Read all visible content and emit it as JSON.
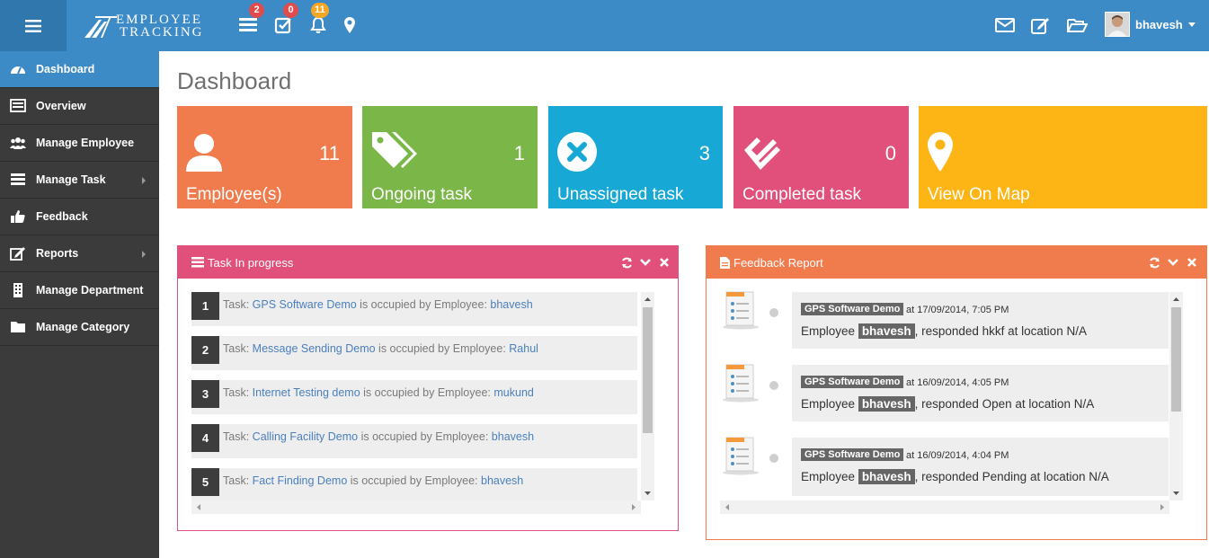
{
  "app": {
    "brand_line1": "EMPLOYEE",
    "brand_line2": "TRACKING"
  },
  "topbar": {
    "badges": {
      "tasks": "2",
      "checks": "0",
      "alerts": "11"
    },
    "user_name": "bhavesh"
  },
  "sidebar": {
    "items": [
      {
        "label": "Dashboard",
        "icon": "dashboard-icon"
      },
      {
        "label": "Overview",
        "icon": "overview-icon"
      },
      {
        "label": "Manage Employee",
        "icon": "users-icon"
      },
      {
        "label": "Manage Task",
        "icon": "tasks-icon"
      },
      {
        "label": "Feedback",
        "icon": "thumbs-up-icon"
      },
      {
        "label": "Reports",
        "icon": "edit-icon"
      },
      {
        "label": "Manage Department",
        "icon": "building-icon"
      },
      {
        "label": "Manage Category",
        "icon": "folder-icon"
      }
    ]
  },
  "main": {
    "title": "Dashboard",
    "tiles": [
      {
        "label": "Employee(s)",
        "count": "11",
        "color": "#f07c4e"
      },
      {
        "label": "Ongoing task",
        "count": "1",
        "color": "#7ab648"
      },
      {
        "label": "Unassigned task",
        "count": "3",
        "color": "#17a8d6"
      },
      {
        "label": "Completed task",
        "count": "0",
        "color": "#e0507a"
      },
      {
        "label": "View On Map",
        "count": "",
        "color": "#fdb515"
      }
    ]
  },
  "task_panel": {
    "title": "Task In progress",
    "color": "#e0507a",
    "prefix": "Task:",
    "middle": "is occupied by Employee:",
    "rows": [
      {
        "num": "1",
        "task": "GPS Software Demo",
        "employee": "bhavesh"
      },
      {
        "num": "2",
        "task": "Message Sending Demo",
        "employee": "Rahul"
      },
      {
        "num": "3",
        "task": "Internet Testing demo",
        "employee": "mukund"
      },
      {
        "num": "4",
        "task": "Calling Facility Demo",
        "employee": "bhavesh"
      },
      {
        "num": "5",
        "task": "Fact Finding Demo",
        "employee": "bhavesh"
      }
    ]
  },
  "feedback_panel": {
    "title": "Feedback Report",
    "color": "#f07c4e",
    "msg_prefix": "Employee",
    "items": [
      {
        "tag": "GPS Software Demo",
        "when": "at 17/09/2014, 7:05 PM",
        "employee": "bhavesh",
        "response": ", responded hkkf at location N/A"
      },
      {
        "tag": "GPS Software Demo",
        "when": "at 16/09/2014, 4:05 PM",
        "employee": "bhavesh",
        "response": ", responded Open at location N/A"
      },
      {
        "tag": "GPS Software Demo",
        "when": "at 16/09/2014, 4:04 PM",
        "employee": "bhavesh",
        "response": ", responded Pending at location N/A"
      }
    ]
  }
}
